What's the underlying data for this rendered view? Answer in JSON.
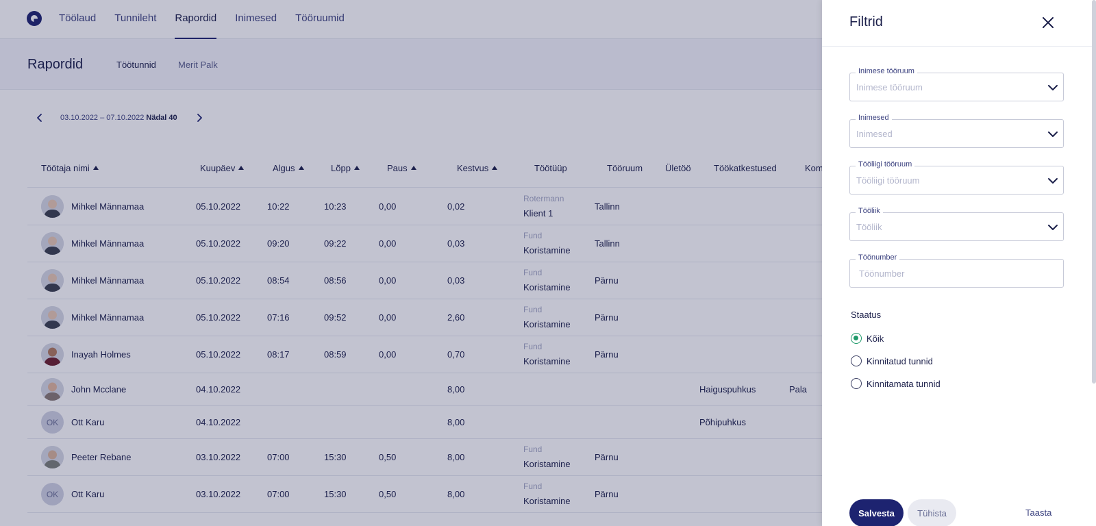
{
  "nav": {
    "items": [
      {
        "label": "Töölaud",
        "active": false
      },
      {
        "label": "Tunnileht",
        "active": false
      },
      {
        "label": "Rapordid",
        "active": true
      },
      {
        "label": "Inimesed",
        "active": false
      },
      {
        "label": "Tööruumid",
        "active": false
      }
    ]
  },
  "header": {
    "title": "Rapordid",
    "tabs": [
      {
        "label": "Töötunnid",
        "active": true
      },
      {
        "label": "Merit Palk",
        "active": false
      }
    ]
  },
  "week": {
    "range": "03.10.2022 – 07.10.2022",
    "label": "Nädal 40"
  },
  "table": {
    "columns": {
      "name": "Töötaja nimi",
      "date": "Kuupäev",
      "start": "Algus",
      "end": "Lõpp",
      "pause": "Paus",
      "duration": "Kestvus",
      "type": "Töötüüp",
      "room": "Tööruum",
      "overtime": "Ületöö",
      "absences": "Töökatkestused",
      "comment": "Kom"
    },
    "rows": [
      {
        "name": "Mihkel Männamaa",
        "initials": "",
        "date": "05.10.2022",
        "start": "10:22",
        "end": "10:23",
        "pause": "0,00",
        "duration": "0,02",
        "type_top": "Rotermann",
        "type_bottom": "Klient 1",
        "room": "Tallinn",
        "absence": "",
        "comment": ""
      },
      {
        "name": "Mihkel Männamaa",
        "initials": "",
        "date": "05.10.2022",
        "start": "09:20",
        "end": "09:22",
        "pause": "0,00",
        "duration": "0,03",
        "type_top": "Fund",
        "type_bottom": "Koristamine",
        "room": "Tallinn",
        "absence": "",
        "comment": ""
      },
      {
        "name": "Mihkel Männamaa",
        "initials": "",
        "date": "05.10.2022",
        "start": "08:54",
        "end": "08:56",
        "pause": "0,00",
        "duration": "0,03",
        "type_top": "Fund",
        "type_bottom": "Koristamine",
        "room": "Pärnu",
        "absence": "",
        "comment": ""
      },
      {
        "name": "Mihkel Männamaa",
        "initials": "",
        "date": "05.10.2022",
        "start": "07:16",
        "end": "09:52",
        "pause": "0,00",
        "duration": "2,60",
        "type_top": "Fund",
        "type_bottom": "Koristamine",
        "room": "Pärnu",
        "absence": "",
        "comment": ""
      },
      {
        "name": "Inayah Holmes",
        "initials": "",
        "date": "05.10.2022",
        "start": "08:17",
        "end": "08:59",
        "pause": "0,00",
        "duration": "0,70",
        "type_top": "Fund",
        "type_bottom": "Koristamine",
        "room": "Pärnu",
        "absence": "",
        "comment": ""
      },
      {
        "name": "John Mcclane",
        "initials": "",
        "date": "04.10.2022",
        "start": "",
        "end": "",
        "pause": "",
        "duration": "8,00",
        "type_top": "",
        "type_bottom": "",
        "room": "",
        "absence": "Haiguspuhkus",
        "comment": "Pala"
      },
      {
        "name": "Ott Karu",
        "initials": "OK",
        "date": "04.10.2022",
        "start": "",
        "end": "",
        "pause": "",
        "duration": "8,00",
        "type_top": "",
        "type_bottom": "",
        "room": "",
        "absence": "Põhipuhkus",
        "comment": ""
      },
      {
        "name": "Peeter Rebane",
        "initials": "",
        "date": "03.10.2022",
        "start": "07:00",
        "end": "15:30",
        "pause": "0,50",
        "duration": "8,00",
        "type_top": "Fund",
        "type_bottom": "Koristamine",
        "room": "Pärnu",
        "absence": "",
        "comment": ""
      },
      {
        "name": "Ott Karu",
        "initials": "OK",
        "date": "03.10.2022",
        "start": "07:00",
        "end": "15:30",
        "pause": "0,50",
        "duration": "8,00",
        "type_top": "Fund",
        "type_bottom": "Koristamine",
        "room": "Pärnu",
        "absence": "",
        "comment": ""
      }
    ]
  },
  "filters": {
    "title": "Filtrid",
    "fields": [
      {
        "label": "Inimese tööruum",
        "placeholder": "Inimese tööruum",
        "dropdown": true
      },
      {
        "label": "Inimesed",
        "placeholder": "Inimesed",
        "dropdown": true
      },
      {
        "label": "Tööliigi tööruum",
        "placeholder": "Tööliigi tööruum",
        "dropdown": true
      },
      {
        "label": "Tööliik",
        "placeholder": "Tööliik",
        "dropdown": true
      },
      {
        "label": "Töönumber",
        "placeholder": "Töönumber",
        "dropdown": false
      }
    ],
    "status": {
      "title": "Staatus",
      "options": [
        {
          "label": "Kõik",
          "checked": true
        },
        {
          "label": "Kinnitatud tunnid",
          "checked": false
        },
        {
          "label": "Kinnitamata tunnid",
          "checked": false
        }
      ]
    },
    "buttons": {
      "save": "Salvesta",
      "cancel": "Tühista",
      "reset": "Taasta"
    }
  },
  "colors": {
    "accent": "#1d2370",
    "radio_checked": "#1e9a6a",
    "overlay": "#1e2050"
  }
}
